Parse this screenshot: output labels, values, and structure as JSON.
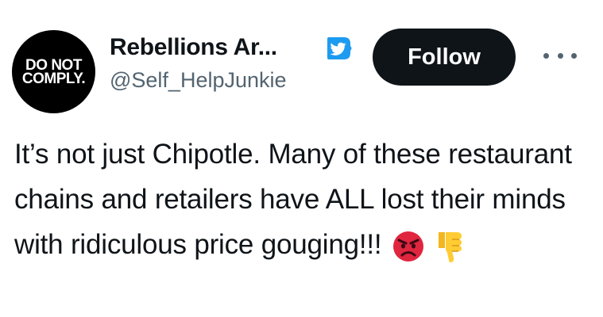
{
  "author": {
    "avatar_text_line1": "DO NOT",
    "avatar_text_line2": "COMPLY.",
    "display_name": "Rebellions Ar...",
    "handle": "@Self_HelpJunkie",
    "verified_badge_color": "#1d9bf0"
  },
  "actions": {
    "follow_label": "Follow",
    "more_icon": "more-horizontal-icon"
  },
  "tweet": {
    "text": "It’s not just Chipotle. Many of these restaurant chains and retailers have ALL lost their minds with ridiculous price gouging!!!",
    "emojis": [
      "angry-face-emoji",
      "thumbs-down-emoji"
    ]
  },
  "colors": {
    "text_primary": "#0f1419",
    "text_secondary": "#536471",
    "button_bg": "#0f1419"
  }
}
